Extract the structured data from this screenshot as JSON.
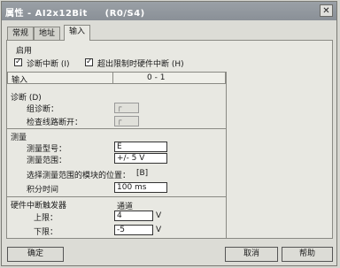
{
  "window": {
    "title": "属性 - AI2x12Bit     (R0/S4)",
    "close_glyph": "✕"
  },
  "tabs": [
    {
      "label": "常规"
    },
    {
      "label": "地址"
    },
    {
      "label": "输入"
    }
  ],
  "enable": {
    "heading": "启用",
    "diagnostic_interrupt": {
      "label": "诊断中断 (I)",
      "checked": true
    },
    "limit_interrupt": {
      "label": "超出限制时硬件中断 (H)",
      "checked": true
    }
  },
  "table": {
    "col1": "输入",
    "col2": "0 - 1"
  },
  "diagnostics": {
    "heading": "诊断 (D)",
    "group_diag": {
      "label": "组诊断："
    },
    "wire_break": {
      "label": "检查线路断开："
    }
  },
  "measurement": {
    "heading": "测量",
    "type_label": "测量型号：",
    "type_value": "E",
    "range_label": "测量范围：",
    "range_value": "+/- 5 V",
    "module_pos_label": "选择测量范围的模块的位置：",
    "module_pos_value": "[B]",
    "integration_label": "积分时间",
    "integration_value": "100 ms"
  },
  "hw_interrupt": {
    "heading": "硬件中断触发器",
    "channel_label": "通道",
    "upper_label": "上限：",
    "upper_value": "4",
    "upper_unit": "V",
    "lower_label": "下限：",
    "lower_value": "-5",
    "lower_unit": "V"
  },
  "buttons": {
    "ok": "确定",
    "cancel": "取消",
    "help": "帮助"
  }
}
